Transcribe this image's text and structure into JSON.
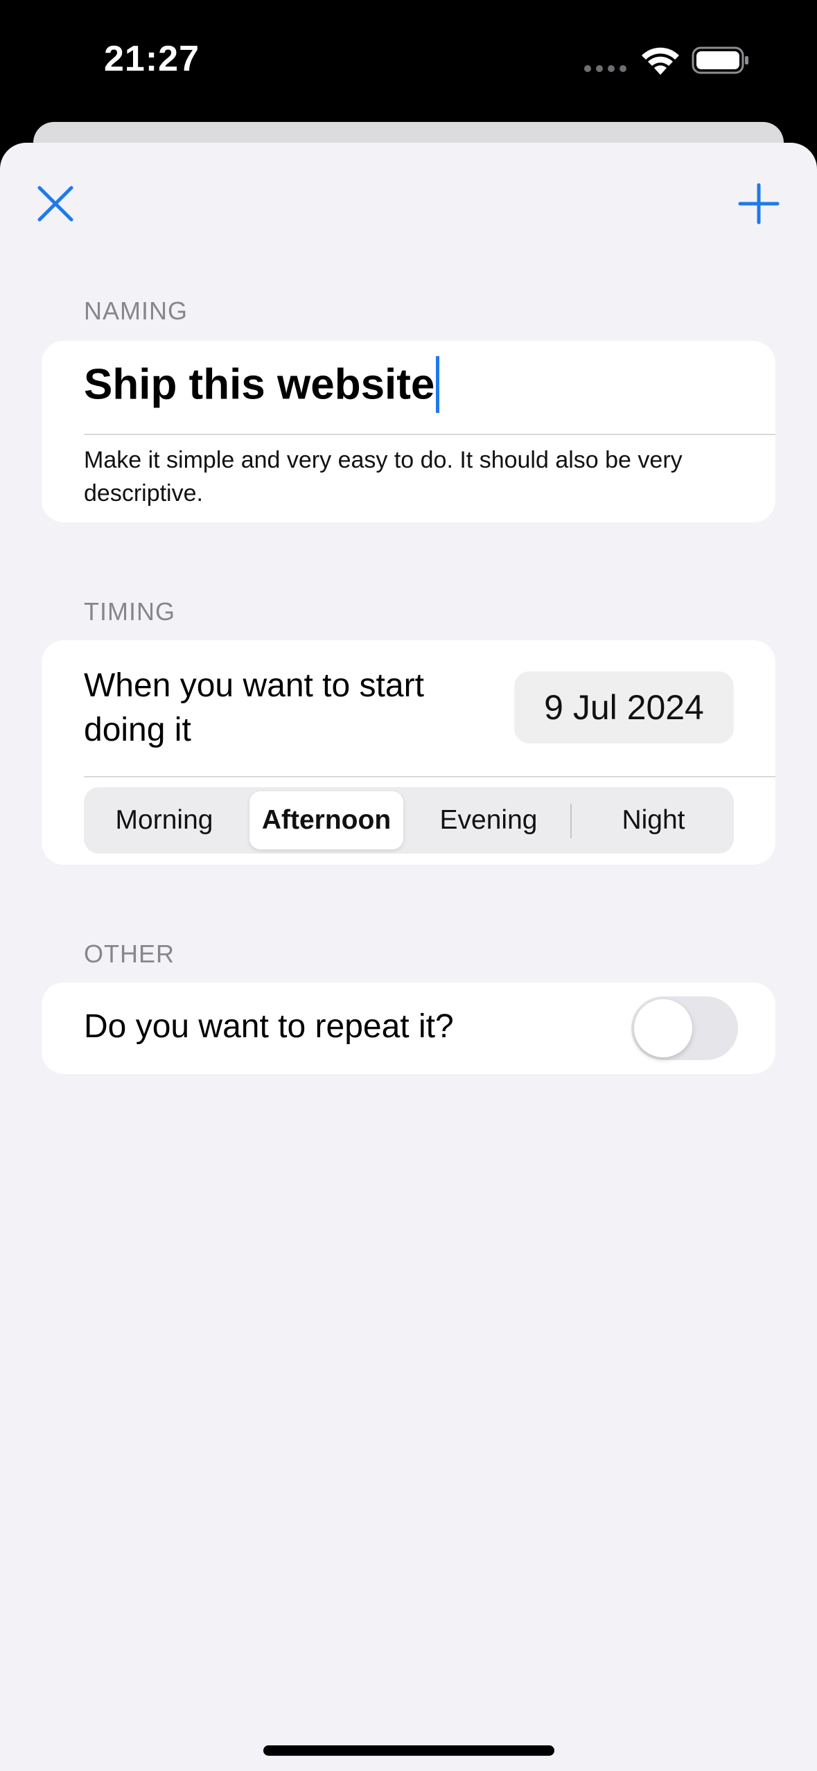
{
  "status_bar": {
    "time": "21:27",
    "icons": [
      "cellular-signal-icon",
      "wifi-icon",
      "battery-icon"
    ]
  },
  "nav": {
    "close_icon": "close-icon",
    "add_icon": "plus-icon",
    "accent_color": "#1f7ae8"
  },
  "naming": {
    "header": "NAMING",
    "title_value": "Ship this website",
    "description": "Make it simple and very easy to do. It should also be very descriptive."
  },
  "timing": {
    "header": "TIMING",
    "start_label": "When you want to start doing it",
    "date_value": "9 Jul 2024",
    "segments": [
      "Morning",
      "Afternoon",
      "Evening",
      "Night"
    ],
    "selected_segment": "Afternoon"
  },
  "other": {
    "header": "OTHER",
    "repeat_label": "Do you want to repeat it?",
    "repeat_enabled": false
  }
}
